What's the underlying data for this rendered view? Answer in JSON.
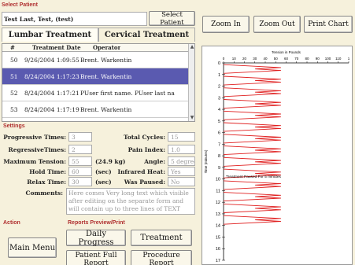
{
  "patient": {
    "section_label": "Select Patient",
    "name": "Test Last, Test, (test)",
    "select_button": "Select Patient"
  },
  "toolbar": {
    "zoom_in": "Zoom In",
    "zoom_out": "Zoom Out",
    "print_chart": "Print Chart"
  },
  "tabs": [
    {
      "label": "Lumbar Treatment",
      "active": true
    },
    {
      "label": "Cervical Treatment",
      "active": false
    }
  ],
  "table": {
    "headers": [
      "#",
      "Treatment Date",
      "Operator"
    ],
    "rows": [
      {
        "num": "50",
        "date": "9/26/2004 1:09:55",
        "operator": "Brent. Warkentin",
        "selected": false
      },
      {
        "num": "51",
        "date": "8/24/2004 1:17:23",
        "operator": "Brent. Warkentin",
        "selected": true
      },
      {
        "num": "52",
        "date": "8/24/2004 1:17:21",
        "operator": "PUser first name. PUser last na",
        "selected": false
      },
      {
        "num": "53",
        "date": "8/24/2004 1:17:19",
        "operator": "Brent. Warkentin",
        "selected": false
      }
    ]
  },
  "settings": {
    "section_label": "Settings",
    "progressive_times_label": "Progressive Times:",
    "progressive_times": "3",
    "regressive_times_label": "RegressiveTimes:",
    "regressive_times": "2",
    "max_tension_label": "Maximum Tension:",
    "max_tension": "55",
    "max_tension_kg": "(24.9 kg)",
    "hold_time_label": "Hold Time:",
    "hold_time": "60",
    "relax_time_label": "Relax Time:",
    "relax_time": "30",
    "sec_unit": "(sec)",
    "total_cycles_label": "Total Cycles:",
    "total_cycles": "15",
    "pain_index_label": "Pain Index:",
    "pain_index": "1.0",
    "angle_label": "Angle:",
    "angle": "5 degrees",
    "infrared_heat_label": "Infrared Heat:",
    "infrared_heat": "Yes",
    "was_paused_label": "Was Paused:",
    "was_paused": "No",
    "comments_label": "Comments:",
    "comments": "Here comes Very long text which visible after editing on the separate form and will contain up to three lines of TEXT"
  },
  "action": {
    "section_label": "Action",
    "main_menu": "Main Menu"
  },
  "reports": {
    "section_label": "Reports Preview/Print",
    "daily_progress": "Daily Progress",
    "treatment": "Treatment",
    "patient_full_report": "Patient Full Report",
    "procedure_report": "Procedure Report"
  },
  "chart_data": {
    "type": "line",
    "title": "Tension in Pounds",
    "xlabel": "Tension in Pounds",
    "ylabel": "Time (minutes)",
    "x_ticks": [
      "0",
      "10",
      "20",
      "30",
      "40",
      "50",
      "60",
      "70",
      "80",
      "90",
      "100",
      "110",
      "1"
    ],
    "y_ticks": [
      "0",
      "1",
      "2",
      "3",
      "4",
      "5",
      "6",
      "7",
      "8",
      "9",
      "10",
      "11",
      "12",
      "13",
      "14",
      "15",
      "16",
      "17"
    ],
    "xlim": [
      0,
      120
    ],
    "ylim": [
      0,
      17
    ],
    "series": [
      {
        "color": "#e02020",
        "cycles": [
          {
            "start_min": 0.5,
            "peak": 55
          },
          {
            "start_min": 1.5,
            "peak": 55
          },
          {
            "start_min": 2.5,
            "peak": 55
          },
          {
            "start_min": 3.5,
            "peak": 55
          },
          {
            "start_min": 4.5,
            "peak": 55
          },
          {
            "start_min": 5.5,
            "peak": 55
          },
          {
            "start_min": 6.5,
            "peak": 55
          },
          {
            "start_min": 7.5,
            "peak": 55
          },
          {
            "start_min": 8.5,
            "peak": 55
          },
          {
            "start_min": 9.5,
            "peak": 55
          },
          {
            "start_min": 10.5,
            "peak": 55
          },
          {
            "start_min": 11.5,
            "peak": 55
          },
          {
            "start_min": 12.5,
            "peak": 55
          },
          {
            "start_min": 13.5,
            "peak": 55
          }
        ]
      }
    ],
    "annotation": {
      "text": "Treatment Paused For 5 minutes",
      "at_min": 9.8
    },
    "grid": false
  }
}
